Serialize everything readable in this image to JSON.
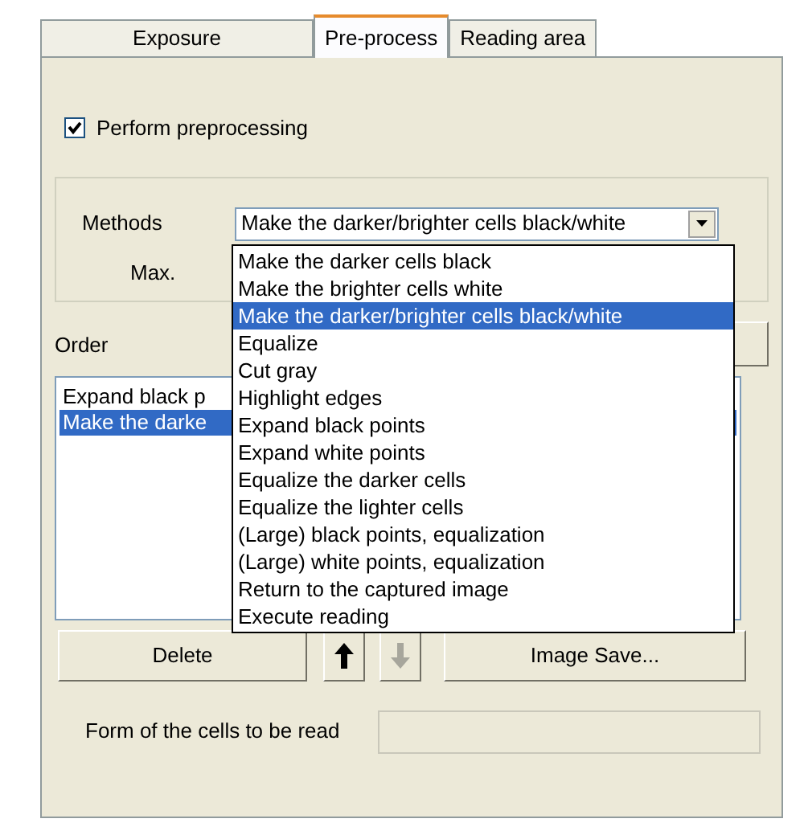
{
  "tabs": [
    {
      "label": "Exposure",
      "selected": false
    },
    {
      "label": "Pre-process",
      "selected": true
    },
    {
      "label": "Reading area",
      "selected": false
    }
  ],
  "perform_preprocessing": {
    "label": "Perform preprocessing",
    "checked": true
  },
  "methods": {
    "label": "Methods",
    "value": "Make the darker/brighter cells black/white",
    "max_label": "Max.",
    "options": [
      {
        "label": "Make the darker cells black",
        "selected": false
      },
      {
        "label": "Make the brighter cells white",
        "selected": false
      },
      {
        "label": "Make the darker/brighter cells black/white",
        "selected": true
      },
      {
        "label": "Equalize",
        "selected": false
      },
      {
        "label": "Cut gray",
        "selected": false
      },
      {
        "label": "Highlight edges",
        "selected": false
      },
      {
        "label": "Expand black points",
        "selected": false
      },
      {
        "label": "Expand white points",
        "selected": false
      },
      {
        "label": "Equalize the darker cells",
        "selected": false
      },
      {
        "label": "Equalize the lighter cells",
        "selected": false
      },
      {
        "label": "(Large) black points, equalization",
        "selected": false
      },
      {
        "label": "(Large) white points, equalization",
        "selected": false
      },
      {
        "label": "Return to the captured image",
        "selected": false
      },
      {
        "label": "Execute reading",
        "selected": false
      }
    ]
  },
  "order": {
    "label": "Order",
    "items": [
      {
        "label": "Expand black p",
        "selected": false
      },
      {
        "label": "Make the darke",
        "selected": true
      }
    ]
  },
  "buttons": {
    "delete": {
      "label": "Delete"
    },
    "up": {
      "disabled": false
    },
    "down": {
      "disabled": true
    },
    "image_save": {
      "label": "Image Save..."
    }
  },
  "form": {
    "label": "Form of the cells to be read"
  }
}
